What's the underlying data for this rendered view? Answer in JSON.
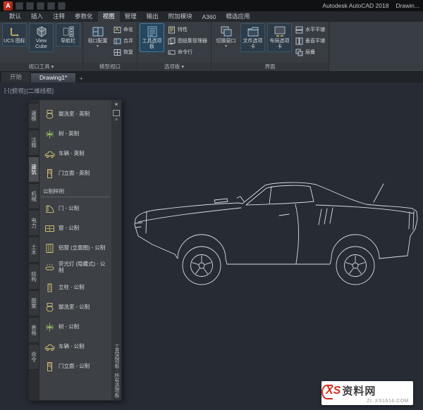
{
  "titlebar": {
    "app_title": "Autodesk AutoCAD 2018",
    "doc_title": "Drawin...",
    "logo_letter": "A"
  },
  "ribbon_tabs": {
    "items": [
      "默认",
      "插入",
      "注释",
      "参数化",
      "视图",
      "管理",
      "输出",
      "附加模块",
      "A360",
      "精选应用"
    ],
    "active": "视图"
  },
  "ribbon": {
    "panels": [
      {
        "label": "视口工具",
        "caret": "▾",
        "buttons": [
          {
            "label": "UCS 图标"
          },
          {
            "label": "View Cube"
          },
          {
            "label": "导航栏"
          }
        ]
      },
      {
        "label": "模型视口",
        "big_button": {
          "label": "视口配置",
          "caret": "▾"
        },
        "buttons": [
          {
            "label": "命名"
          },
          {
            "label": "合并"
          },
          {
            "label": "恢复"
          }
        ]
      },
      {
        "label": "选项板",
        "caret": "▾",
        "big_button": {
          "label": "工具选项板"
        },
        "buttons": [
          {
            "label": "特性"
          },
          {
            "label": "图纸集管理器"
          },
          {
            "label": "命令行"
          }
        ]
      },
      {
        "label": "界面",
        "big_button": {
          "label": "切换窗口",
          "caret": "▾"
        },
        "toggle_buttons": [
          {
            "label": "文件选项卡"
          },
          {
            "label": "布局选项卡"
          }
        ],
        "small_buttons": [
          {
            "label": "水平平铺"
          },
          {
            "label": "垂直平铺"
          },
          {
            "label": "层叠"
          }
        ]
      }
    ]
  },
  "file_tabs": {
    "tabs": [
      {
        "label": "开始"
      },
      {
        "label": "Drawing1*"
      }
    ],
    "new_tab_label": "+"
  },
  "viewport": {
    "controls": [
      "[-]",
      "[俯视]",
      "[二维线框]"
    ]
  },
  "palette": {
    "close_label": "×",
    "menu_icon": "≡",
    "tabs": [
      "建模",
      "注释",
      "建筑",
      "机械",
      "电力",
      "土木",
      "结构",
      "图案",
      "表格",
      "命令"
    ],
    "active_tab": "建筑",
    "imperial_items": [
      {
        "label": "盥洗室 - 英制",
        "icon": "lavatory-icon"
      },
      {
        "label": "树 - 英制",
        "icon": "tree-icon"
      },
      {
        "label": "车辆 - 英制",
        "icon": "vehicle-icon"
      },
      {
        "label": "门立面 - 英制",
        "icon": "door-elevation-icon"
      }
    ],
    "section_label": "公制样例",
    "metric_items": [
      {
        "label": "门 - 公制",
        "icon": "door-icon"
      },
      {
        "label": "窗 - 公制",
        "icon": "window-icon"
      },
      {
        "label": "铝窗 (立面图) - 公制",
        "icon": "aluminum-window-icon"
      },
      {
        "label": "荧光灯 (隐藏式) - 公制",
        "icon": "fluorescent-light-icon"
      },
      {
        "label": "立柱 - 公制",
        "icon": "column-icon"
      },
      {
        "label": "盥洗室 - 公制",
        "icon": "lavatory-icon"
      },
      {
        "label": "树 - 公制",
        "icon": "tree-icon"
      },
      {
        "label": "车辆 - 公制",
        "icon": "vehicle-icon"
      },
      {
        "label": "门立面 - 公制",
        "icon": "door-elevation-icon"
      }
    ],
    "vertical_title": "工具选项板 - 所有选项板"
  },
  "canvas": {
    "drawing_description": "classic coupe car side-view white line drawing"
  },
  "watermark": {
    "logo_text": "XS",
    "site_name": "资料网",
    "site_url": "ZL.XS1616.COM"
  },
  "colors": {
    "canvas_bg": "#262b34",
    "ribbon_bg": "#383d43",
    "line_color": "#d9dde2",
    "active_blue": "#25465e",
    "watermark_red": "#d42d1f"
  }
}
